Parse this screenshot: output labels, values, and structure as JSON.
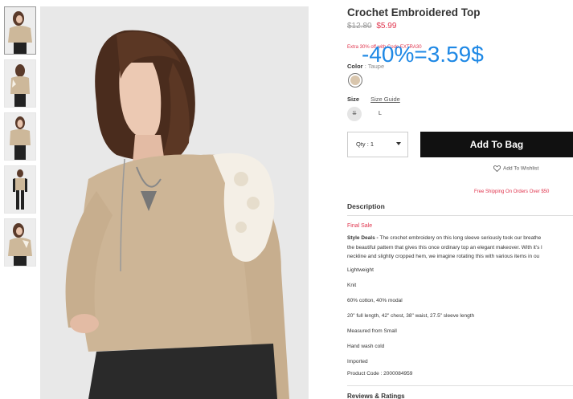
{
  "product": {
    "title": "Crochet Embroidered Top",
    "old_price": "$12.80",
    "new_price": "$5.99",
    "promo": "Extra 30% off with Code EXTRA30",
    "overlay_text": "-40%=3.59$",
    "color_label": "Color",
    "color_value": ": Taupe",
    "size_label": "Size",
    "size_guide": "Size Guide",
    "sizes": [
      "S",
      "L"
    ],
    "swatch_color": "#d9c6ad"
  },
  "purchase": {
    "qty_label": "Qty : 1",
    "add_to_bag": "Add To Bag",
    "wishlist": "Add To Wishlist",
    "shipping": "Free Shipping On Orders Over $50"
  },
  "description": {
    "heading": "Description",
    "final_sale": "Final Sale",
    "style_deals_label": "Style Deals -",
    "style_deals_lines": [
      " The crochet embroidery on this long sleeve seriously took our breathe",
      "the beautiful pattern that gives this once ordinary top an elegant makeover. With it's l",
      "neckline and slightly cropped hem, we imagine rotating this with various items in ou"
    ],
    "facts": [
      "Lightweight",
      "Knit",
      "60% cotton, 40% modal",
      "20\" full length, 42\" chest, 38\" waist, 27.5\" sleeve length",
      "Measured from Small",
      "Hand wash cold",
      "Imported",
      "Product Code : 2000084959"
    ]
  },
  "reviews_heading": "Reviews & Ratings",
  "colors": {
    "accent_red": "#e0344d",
    "button_black": "#111111",
    "overlay_blue": "#1e88e5"
  }
}
